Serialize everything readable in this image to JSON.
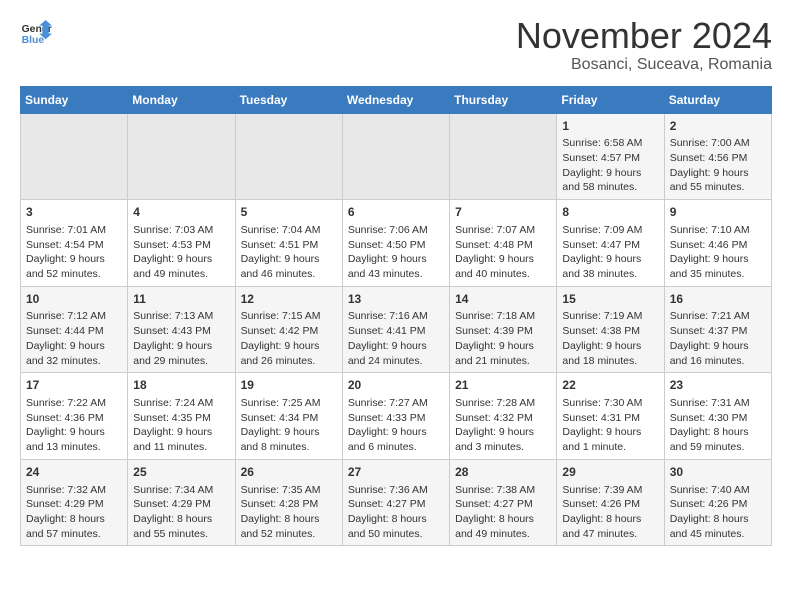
{
  "logo": {
    "line1": "General",
    "line2": "Blue"
  },
  "title": "November 2024",
  "subtitle": "Bosanci, Suceava, Romania",
  "weekdays": [
    "Sunday",
    "Monday",
    "Tuesday",
    "Wednesday",
    "Thursday",
    "Friday",
    "Saturday"
  ],
  "weeks": [
    [
      {
        "day": "",
        "info": ""
      },
      {
        "day": "",
        "info": ""
      },
      {
        "day": "",
        "info": ""
      },
      {
        "day": "",
        "info": ""
      },
      {
        "day": "",
        "info": ""
      },
      {
        "day": "1",
        "info": "Sunrise: 6:58 AM\nSunset: 4:57 PM\nDaylight: 9 hours and 58 minutes."
      },
      {
        "day": "2",
        "info": "Sunrise: 7:00 AM\nSunset: 4:56 PM\nDaylight: 9 hours and 55 minutes."
      }
    ],
    [
      {
        "day": "3",
        "info": "Sunrise: 7:01 AM\nSunset: 4:54 PM\nDaylight: 9 hours and 52 minutes."
      },
      {
        "day": "4",
        "info": "Sunrise: 7:03 AM\nSunset: 4:53 PM\nDaylight: 9 hours and 49 minutes."
      },
      {
        "day": "5",
        "info": "Sunrise: 7:04 AM\nSunset: 4:51 PM\nDaylight: 9 hours and 46 minutes."
      },
      {
        "day": "6",
        "info": "Sunrise: 7:06 AM\nSunset: 4:50 PM\nDaylight: 9 hours and 43 minutes."
      },
      {
        "day": "7",
        "info": "Sunrise: 7:07 AM\nSunset: 4:48 PM\nDaylight: 9 hours and 40 minutes."
      },
      {
        "day": "8",
        "info": "Sunrise: 7:09 AM\nSunset: 4:47 PM\nDaylight: 9 hours and 38 minutes."
      },
      {
        "day": "9",
        "info": "Sunrise: 7:10 AM\nSunset: 4:46 PM\nDaylight: 9 hours and 35 minutes."
      }
    ],
    [
      {
        "day": "10",
        "info": "Sunrise: 7:12 AM\nSunset: 4:44 PM\nDaylight: 9 hours and 32 minutes."
      },
      {
        "day": "11",
        "info": "Sunrise: 7:13 AM\nSunset: 4:43 PM\nDaylight: 9 hours and 29 minutes."
      },
      {
        "day": "12",
        "info": "Sunrise: 7:15 AM\nSunset: 4:42 PM\nDaylight: 9 hours and 26 minutes."
      },
      {
        "day": "13",
        "info": "Sunrise: 7:16 AM\nSunset: 4:41 PM\nDaylight: 9 hours and 24 minutes."
      },
      {
        "day": "14",
        "info": "Sunrise: 7:18 AM\nSunset: 4:39 PM\nDaylight: 9 hours and 21 minutes."
      },
      {
        "day": "15",
        "info": "Sunrise: 7:19 AM\nSunset: 4:38 PM\nDaylight: 9 hours and 18 minutes."
      },
      {
        "day": "16",
        "info": "Sunrise: 7:21 AM\nSunset: 4:37 PM\nDaylight: 9 hours and 16 minutes."
      }
    ],
    [
      {
        "day": "17",
        "info": "Sunrise: 7:22 AM\nSunset: 4:36 PM\nDaylight: 9 hours and 13 minutes."
      },
      {
        "day": "18",
        "info": "Sunrise: 7:24 AM\nSunset: 4:35 PM\nDaylight: 9 hours and 11 minutes."
      },
      {
        "day": "19",
        "info": "Sunrise: 7:25 AM\nSunset: 4:34 PM\nDaylight: 9 hours and 8 minutes."
      },
      {
        "day": "20",
        "info": "Sunrise: 7:27 AM\nSunset: 4:33 PM\nDaylight: 9 hours and 6 minutes."
      },
      {
        "day": "21",
        "info": "Sunrise: 7:28 AM\nSunset: 4:32 PM\nDaylight: 9 hours and 3 minutes."
      },
      {
        "day": "22",
        "info": "Sunrise: 7:30 AM\nSunset: 4:31 PM\nDaylight: 9 hours and 1 minute."
      },
      {
        "day": "23",
        "info": "Sunrise: 7:31 AM\nSunset: 4:30 PM\nDaylight: 8 hours and 59 minutes."
      }
    ],
    [
      {
        "day": "24",
        "info": "Sunrise: 7:32 AM\nSunset: 4:29 PM\nDaylight: 8 hours and 57 minutes."
      },
      {
        "day": "25",
        "info": "Sunrise: 7:34 AM\nSunset: 4:29 PM\nDaylight: 8 hours and 55 minutes."
      },
      {
        "day": "26",
        "info": "Sunrise: 7:35 AM\nSunset: 4:28 PM\nDaylight: 8 hours and 52 minutes."
      },
      {
        "day": "27",
        "info": "Sunrise: 7:36 AM\nSunset: 4:27 PM\nDaylight: 8 hours and 50 minutes."
      },
      {
        "day": "28",
        "info": "Sunrise: 7:38 AM\nSunset: 4:27 PM\nDaylight: 8 hours and 49 minutes."
      },
      {
        "day": "29",
        "info": "Sunrise: 7:39 AM\nSunset: 4:26 PM\nDaylight: 8 hours and 47 minutes."
      },
      {
        "day": "30",
        "info": "Sunrise: 7:40 AM\nSunset: 4:26 PM\nDaylight: 8 hours and 45 minutes."
      }
    ]
  ]
}
